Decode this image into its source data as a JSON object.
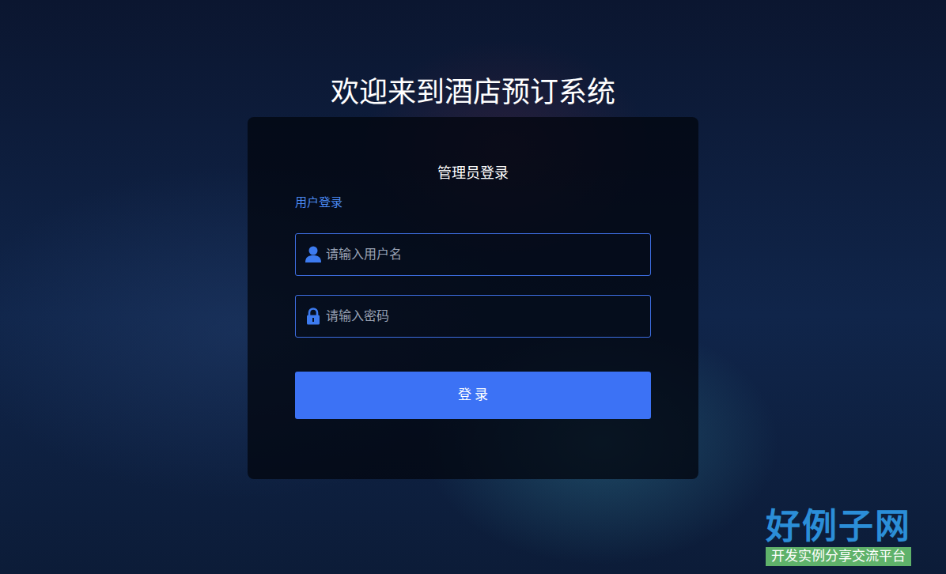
{
  "page": {
    "title": "欢迎来到酒店预订系统"
  },
  "login": {
    "heading": "管理员登录",
    "switch_link": "用户登录",
    "username": {
      "placeholder": "请输入用户名"
    },
    "password": {
      "placeholder": "请输入密码"
    },
    "submit": "登 录"
  },
  "watermark": {
    "brand": "好例子网",
    "tagline": "开发实例分享交流平台"
  }
}
